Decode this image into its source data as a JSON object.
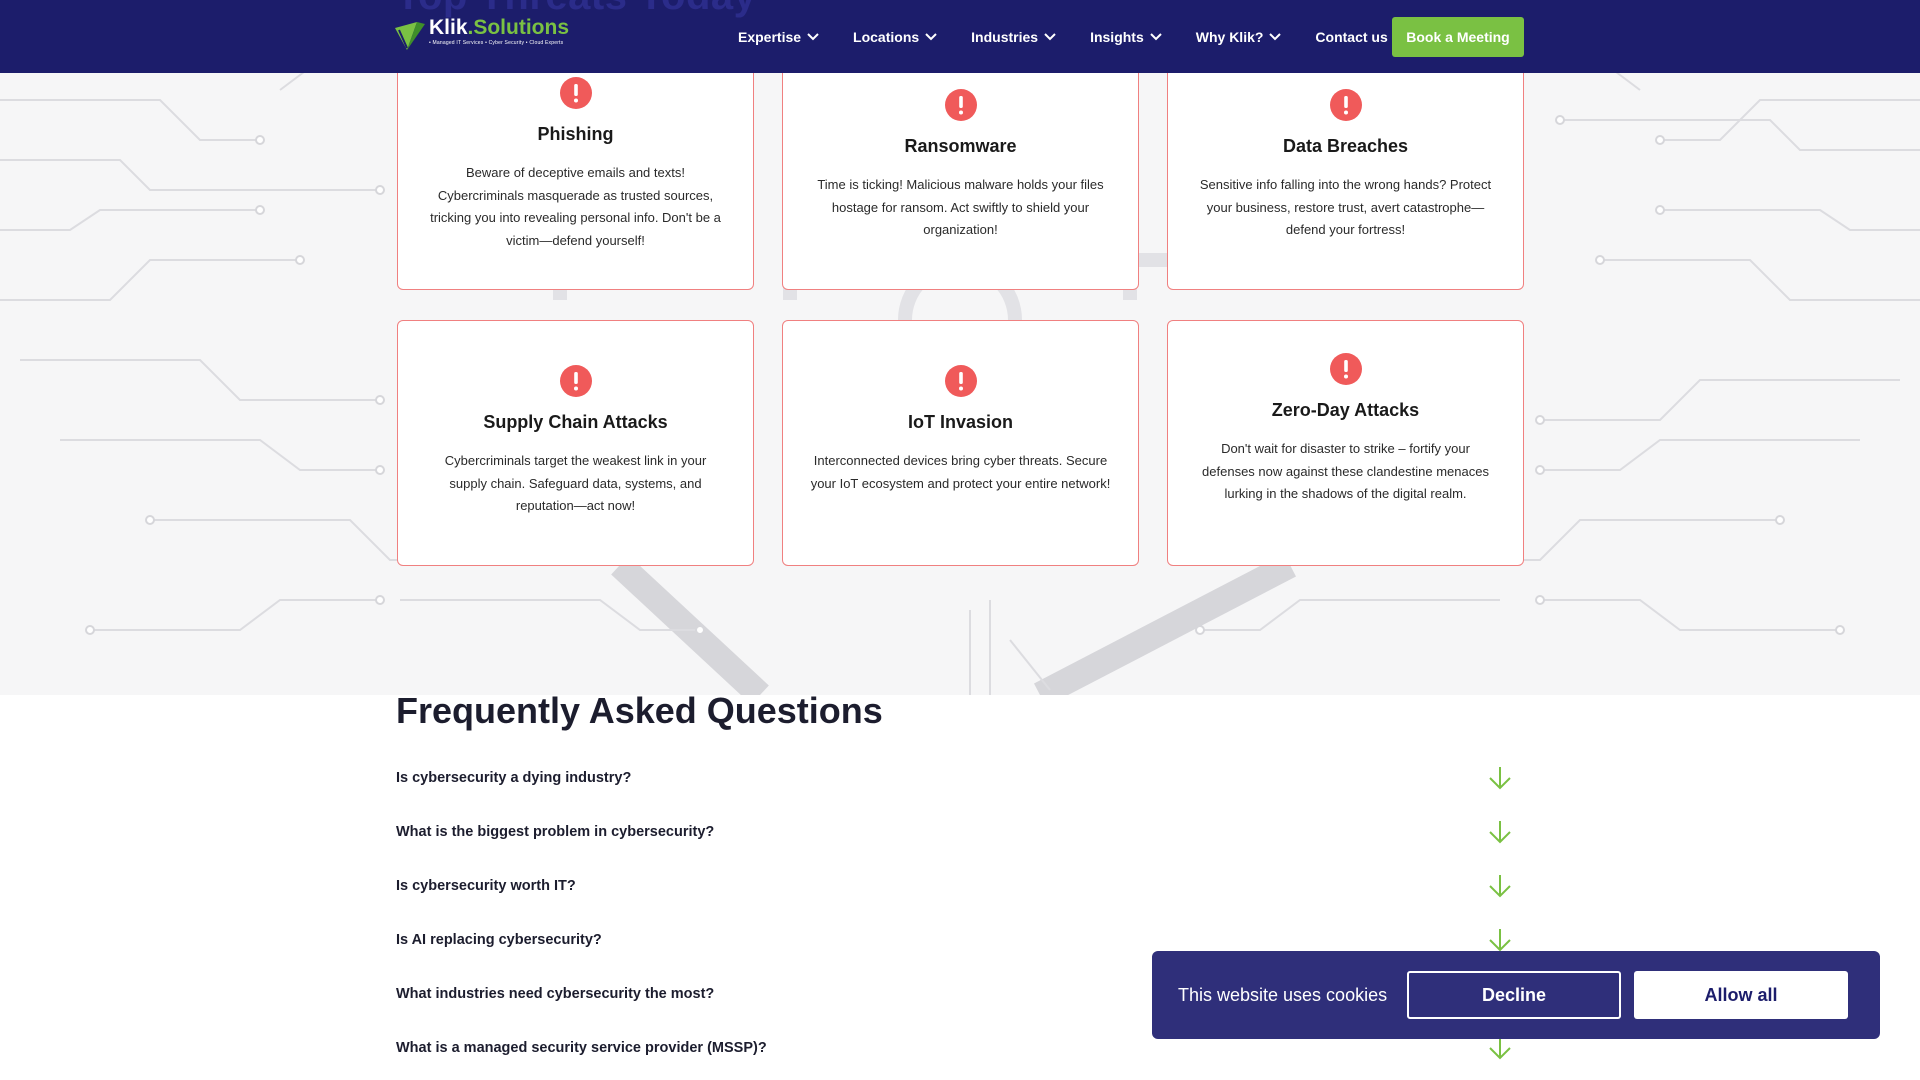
{
  "header": {
    "partial_heading": "Top Threats Today",
    "logo": {
      "brand_main": "Klik",
      "brand_accent": ".Solutions",
      "tagline": "• Managed IT Services • Cyber Security • Cloud Experts"
    },
    "nav": [
      {
        "label": "Expertise",
        "has_dropdown": true
      },
      {
        "label": "Locations",
        "has_dropdown": true
      },
      {
        "label": "Industries",
        "has_dropdown": true
      },
      {
        "label": "Insights",
        "has_dropdown": true
      },
      {
        "label": "Why Klik?",
        "has_dropdown": true
      },
      {
        "label": "Contact us",
        "has_dropdown": false
      }
    ],
    "cta_label": "Book a Meeting"
  },
  "threats": [
    {
      "title": "Phishing",
      "description": "Beware of deceptive emails and texts! Cybercriminals masquerade as trusted sources, tricking you into revealing personal info. Don't be a victim—defend yourself!",
      "icon": "alert-icon"
    },
    {
      "title": "Ransomware",
      "description": "Time is ticking! Malicious malware holds your files hostage for ransom. Act swiftly to shield your organization!",
      "icon": "alert-icon"
    },
    {
      "title": "Data Breaches",
      "description": "Sensitive info falling into the wrong hands? Protect your business, restore trust, avert catastrophe—defend your fortress!",
      "icon": "alert-icon"
    },
    {
      "title": "Supply Chain Attacks",
      "description": "Cybercriminals target the weakest link in your supply chain. Safeguard data, systems, and reputation—act now!",
      "icon": "alert-icon"
    },
    {
      "title": "IoT Invasion",
      "description": "Interconnected devices bring cyber threats. Secure your IoT ecosystem and protect your entire network!",
      "icon": "alert-icon"
    },
    {
      "title": "Zero-Day Attacks",
      "description": "Don't wait for disaster to strike – fortify your defenses now against these clandestine menaces lurking in the shadows of the digital realm.",
      "icon": "alert-icon"
    }
  ],
  "faq": {
    "title": "Frequently Asked Questions",
    "items": [
      "Is cybersecurity a dying industry?",
      "What is the biggest problem in cybersecurity?",
      "Is cybersecurity worth IT?",
      "Is AI replacing cybersecurity?",
      "What industries need cybersecurity the most?",
      "What is a managed security service provider (MSSP)?"
    ]
  },
  "cookie_banner": {
    "message": "This website uses cookies",
    "decline_label": "Decline",
    "allow_label": "Allow all"
  },
  "colors": {
    "header_bg": "#1c1d6b",
    "accent_green": "#7ac143",
    "alert_red": "#f05a5a",
    "card_border": "#f08080",
    "cookie_bg": "#2f2f7a"
  }
}
